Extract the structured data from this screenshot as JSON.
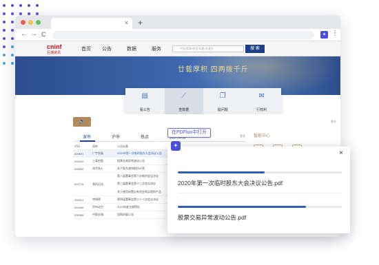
{
  "colors": {
    "accent": "#4a4ed8",
    "site_primary": "#1d3f87",
    "progress": "#2f5fb3",
    "gold": "#b08a5c"
  },
  "browser": {
    "tab_close": "×",
    "new_tab": "+",
    "nav_back": "←",
    "nav_forward": "→",
    "nav_reload": "C",
    "menu": "⋮",
    "extension_icon": "extension-icon"
  },
  "site": {
    "logo": "cninf",
    "logo_sub": "巨潮资讯",
    "nav": [
      "首页",
      "公告",
      "数据",
      "服务"
    ],
    "search_placeholder": "代码/简称/拼音/标题/关键字",
    "search_button": "搜 索",
    "banner_slogan": "廿载厚积 四两拨千斤",
    "quick_links": [
      {
        "label": "看公告",
        "icon": "announcement-icon"
      },
      {
        "label": "查数据",
        "icon": "chart-icon"
      },
      {
        "label": "提问题",
        "icon": "question-icon"
      },
      {
        "label": "行权利",
        "icon": "rights-icon"
      }
    ],
    "speaker_icon": "speaker-icon",
    "more_top": "更多",
    "list_tabs": [
      "深市",
      "沪市",
      "热点",
      "我的公告"
    ],
    "more": "更多",
    "table": {
      "headers": [
        "代码",
        "简称",
        "公告标题"
      ],
      "rows": [
        {
          "code": "000537",
          "name": "广宇发展",
          "title": "2020年第一次临时股东大会决议公告"
        },
        {
          "code": "002312",
          "name": "三泰控股",
          "title": "股票交易异常波动公告"
        },
        {
          "code": "000020",
          "name": "深华发A",
          "title": "关于股东减持股份计划"
        },
        {
          "code": "002778",
          "name": "高科石化",
          "titles": [
            "第八届董事会第六次临时会议决议",
            "第三届董事会第十三次会议决议",
            "关于使用闲置自有资金购买理财产品"
          ]
        },
        {
          "code": "300001",
          "name": "特锐德",
          "title": "第四届董事会第二十八次会议决议"
        },
        {
          "code": "001696",
          "name": "宗申动力",
          "title": "2019年度业绩预告"
        },
        {
          "code": "000066",
          "name": "中国长城",
          "title": "回购进展公告"
        }
      ]
    },
    "side_title": "智能中心",
    "side_icons": [
      "document-icon",
      "grid-icon",
      "edit-icon"
    ]
  },
  "tooltip": "在PDFlux中打开",
  "downloads": {
    "badge": "extension-icon",
    "close": "×",
    "items": [
      {
        "name": "2020年第一次临时股东大会决议公告.pdf",
        "progress": 0.53
      },
      {
        "name": "股票交易异常波动公告.pdf",
        "progress": 0.78
      }
    ]
  }
}
